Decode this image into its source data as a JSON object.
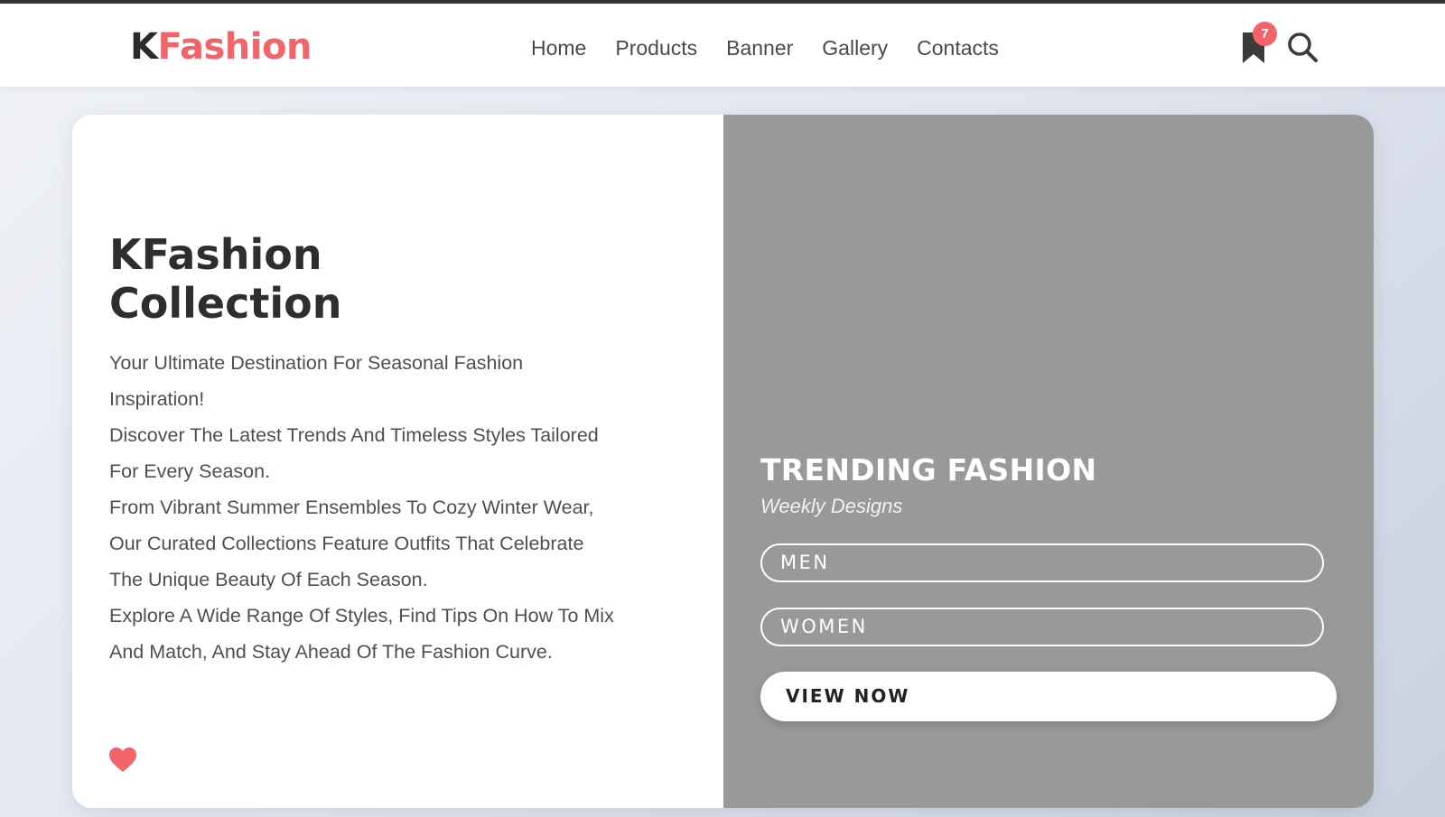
{
  "brand": {
    "k": "K",
    "rest": "Fashion",
    "accent_color": "#f2646a"
  },
  "nav": {
    "items": [
      {
        "label": "Home"
      },
      {
        "label": "Products"
      },
      {
        "label": "Banner"
      },
      {
        "label": "Gallery"
      },
      {
        "label": "Contacts"
      }
    ]
  },
  "header_icons": {
    "bookmark_icon": "bookmark-icon",
    "bookmark_badge": "7",
    "search_icon": "search-icon"
  },
  "hero": {
    "title_line1": "KFashion",
    "title_line2": "Collection",
    "lines": [
      "Your Ultimate Destination For Seasonal Fashion",
      "Inspiration!",
      "Discover The Latest Trends And Timeless Styles Tailored",
      "For Every Season.",
      "From Vibrant Summer Ensembles To Cozy Winter Wear,",
      "Our Curated Collections Feature Outfits That Celebrate",
      "The Unique Beauty Of Each Season.",
      "Explore A Wide Range Of Styles, Find Tips On How To Mix",
      "And Match, And Stay Ahead Of The Fashion Curve."
    ],
    "heart_icon": "heart-icon"
  },
  "trending": {
    "title": "TRENDING FASHION",
    "subtitle": "Weekly Designs",
    "men_label": "MEN",
    "women_label": "WOMEN",
    "view_label": "VIEW NOW",
    "panel_color": "#999999"
  }
}
